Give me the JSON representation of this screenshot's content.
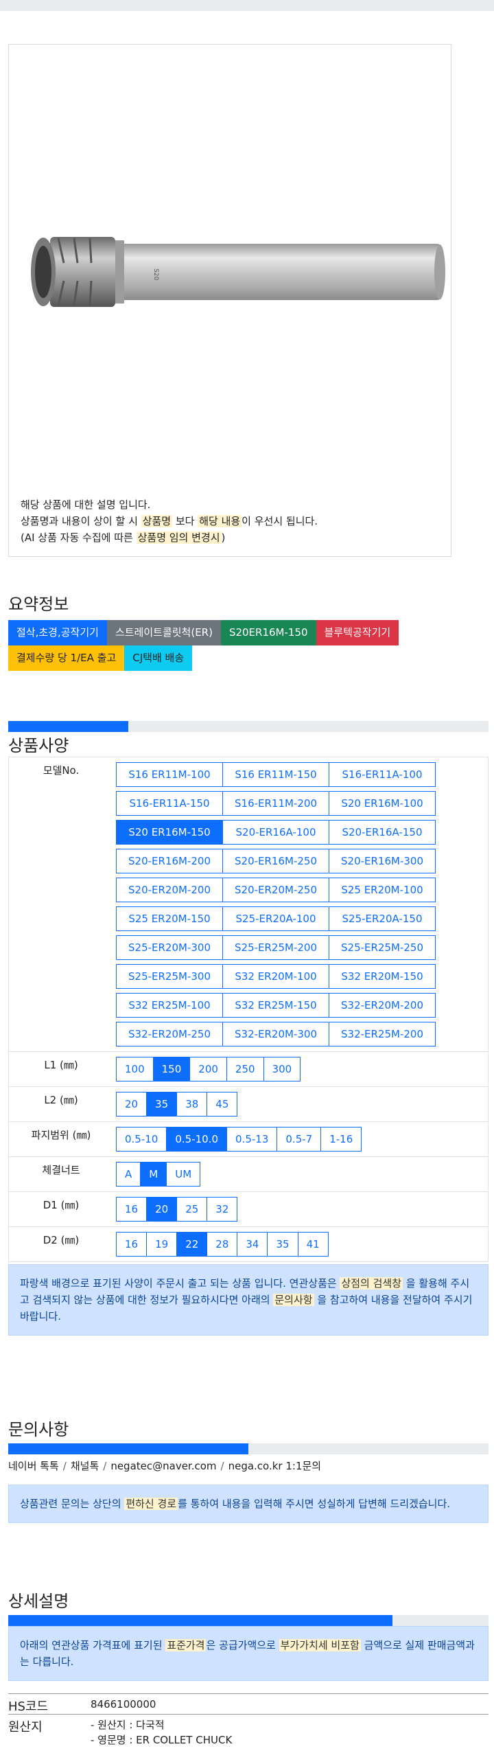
{
  "product_image": {
    "description_lines": [
      [
        {
          "t": "해당 상품에 대한 설명 입니다.",
          "h": false
        }
      ],
      [
        {
          "t": "상품명과 내용이 상이 할 시 ",
          "h": false
        },
        {
          "t": "상품명",
          "h": true
        },
        {
          "t": " 보다 ",
          "h": false
        },
        {
          "t": "해당 내용",
          "h": true
        },
        {
          "t": "이 우선시 됩니다.",
          "h": false
        }
      ],
      [
        {
          "t": "(AI 상품 자동 수집에 따른 ",
          "h": false
        },
        {
          "t": "상품명 임의 변경시",
          "h": true
        },
        {
          "t": ")",
          "h": false
        }
      ]
    ]
  },
  "summary": {
    "title": "요약정보",
    "tags_row1": [
      {
        "label": "절삭,초경,공작기기",
        "color": "#0d6efd"
      },
      {
        "label": "스트레이트콜릿척(ER)",
        "color": "#6c757d"
      },
      {
        "label": "S20ER16M-150",
        "color": "#198754"
      },
      {
        "label": "블루텍공작기기",
        "color": "#dc3545"
      }
    ],
    "tags_row2": [
      {
        "label": "결제수량 당 1/EA 출고",
        "color": "#ffc107",
        "text": "#222"
      },
      {
        "label": "CJ택배 배송",
        "color": "#0dcaf0",
        "text": "#222"
      }
    ]
  },
  "spec": {
    "title": "상품사양",
    "progress": 0.25,
    "model_label": "모델No.",
    "models": [
      [
        "S16 ER11M-100",
        "S16 ER11M-150",
        "S16-ER11A-100"
      ],
      [
        "S16-ER11A-150",
        "S16-ER11M-200",
        "S20 ER16M-100"
      ],
      [
        "S20 ER16M-150",
        "S20-ER16A-100",
        "S20-ER16A-150"
      ],
      [
        "S20-ER16M-200",
        "S20-ER16M-250",
        "S20-ER16M-300"
      ],
      [
        "S20-ER20M-200",
        "S20-ER20M-250",
        "S25 ER20M-100"
      ],
      [
        "S25 ER20M-150",
        "S25-ER20A-100",
        "S25-ER20A-150"
      ],
      [
        "S25-ER20M-300",
        "S25-ER25M-200",
        "S25-ER25M-250"
      ],
      [
        "S25-ER25M-300",
        "S32 ER20M-100",
        "S32 ER20M-150"
      ],
      [
        "S32 ER25M-100",
        "S32 ER25M-150",
        "S32-ER20M-200"
      ],
      [
        "S32-ER20M-250",
        "S32-ER20M-300",
        "S32-ER25M-200"
      ]
    ],
    "selected_model": "S20 ER16M-150",
    "options": [
      {
        "label": "L1 (㎜)",
        "values": [
          "100",
          "150",
          "200",
          "250",
          "300"
        ],
        "selected": "150"
      },
      {
        "label": "L2 (㎜)",
        "values": [
          "20",
          "35",
          "38",
          "45"
        ],
        "selected": "35"
      },
      {
        "label": "파지범위 (㎜)",
        "values": [
          "0.5-10",
          "0.5-10.0",
          "0.5-13",
          "0.5-7",
          "1-16"
        ],
        "selected": "0.5-10.0"
      },
      {
        "label": "체결너트",
        "values": [
          "A",
          "M",
          "UM"
        ],
        "selected": "M"
      },
      {
        "label": "D1 (㎜)",
        "values": [
          "16",
          "20",
          "25",
          "32"
        ],
        "selected": "20"
      },
      {
        "label": "D2 (㎜)",
        "values": [
          "16",
          "19",
          "22",
          "28",
          "34",
          "35",
          "41"
        ],
        "selected": "22"
      }
    ],
    "notice": [
      {
        "t": "파랑색 배경으로 표기된 사양이 주문시 출고 되는 상품 입니다. 연관상품은 ",
        "h": false
      },
      {
        "t": "상점의 검색창",
        "h": true
      },
      {
        "t": " 을 활용해 주시고 검색되지 않는 상품에 대한 정보가 필요하시다면 아래의 ",
        "h": false
      },
      {
        "t": "문의사항",
        "h": true
      },
      {
        "t": " 을 참고하여 내용을 전달하여 주시기 바랍니다.",
        "h": false
      }
    ]
  },
  "inquiry": {
    "title": "문의사항",
    "progress": 0.5,
    "channels": [
      "네이버 톡톡",
      "채널톡",
      "negatec@naver.com",
      "nega.co.kr 1:1문의"
    ],
    "notice": [
      {
        "t": "상품관련 문의는 상단의 ",
        "h": false
      },
      {
        "t": "편하신 경로",
        "h": true
      },
      {
        "t": "를 통하여 내용을 입력해 주시면 성실하게 답변해 드리겠습니다.",
        "h": false
      }
    ]
  },
  "detail": {
    "title": "상세설명",
    "progress": 0.8,
    "notice": [
      {
        "t": "아래의 연관상품 가격표에 표기된 ",
        "h": false
      },
      {
        "t": "표준가격",
        "h": true
      },
      {
        "t": "은 공급가액으로 ",
        "h": false
      },
      {
        "t": "부가가치세 비포함",
        "h": true
      },
      {
        "t": " 금액으로 실제 판매금액과는 다릅니다.",
        "h": false
      }
    ],
    "hs_label": "HS코드",
    "hs_value": "8466100000",
    "origin_label": "원산지",
    "origin_lines": [
      "- 원산지 : 다국적",
      "- 영문명 : ER COLLET CHUCK"
    ]
  }
}
